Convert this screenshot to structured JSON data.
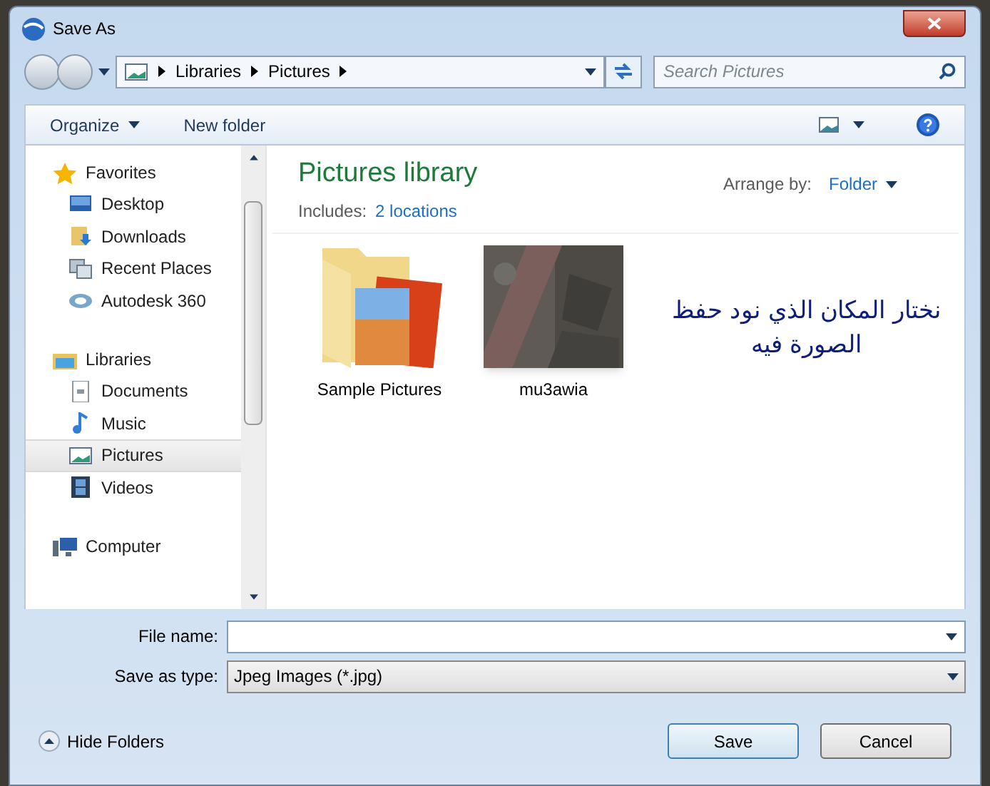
{
  "window": {
    "title": "Save As"
  },
  "address": {
    "crumbs": [
      "Libraries",
      "Pictures"
    ]
  },
  "search": {
    "placeholder": "Search Pictures"
  },
  "toolbar": {
    "organize": "Organize",
    "new_folder": "New folder"
  },
  "sidebar": [
    {
      "label": "Favorites",
      "kind": "star",
      "children": [
        {
          "label": "Desktop",
          "kind": "desktop",
          "selected": false
        },
        {
          "label": "Downloads",
          "kind": "download",
          "selected": false
        },
        {
          "label": "Recent Places",
          "kind": "recent",
          "selected": false
        },
        {
          "label": "Autodesk 360",
          "kind": "cloud",
          "selected": false
        }
      ]
    },
    {
      "label": "Libraries",
      "kind": "library",
      "children": [
        {
          "label": "Documents",
          "kind": "document",
          "selected": false
        },
        {
          "label": "Music",
          "kind": "music",
          "selected": false
        },
        {
          "label": "Pictures",
          "kind": "pictures",
          "selected": true
        },
        {
          "label": "Videos",
          "kind": "video",
          "selected": false
        }
      ]
    },
    {
      "label": "Computer",
      "kind": "computer"
    }
  ],
  "library": {
    "title": "Pictures library",
    "includes_label": "Includes:",
    "includes_link": "2 locations",
    "arrange_label": "Arrange by:",
    "arrange_value": "Folder"
  },
  "items": [
    {
      "label": "Sample Pictures",
      "kind": "folder"
    },
    {
      "label": "mu3awia",
      "kind": "picture"
    }
  ],
  "note": "نختار المكان الذي نود حفظ\nالصورة فيه",
  "form": {
    "file_name_label": "File name:",
    "type_label": "Save as type:",
    "type_value": "Jpeg Images (*.jpg)"
  },
  "hide_folders": "Hide Folders",
  "buttons": {
    "save": "Save",
    "cancel": "Cancel"
  }
}
